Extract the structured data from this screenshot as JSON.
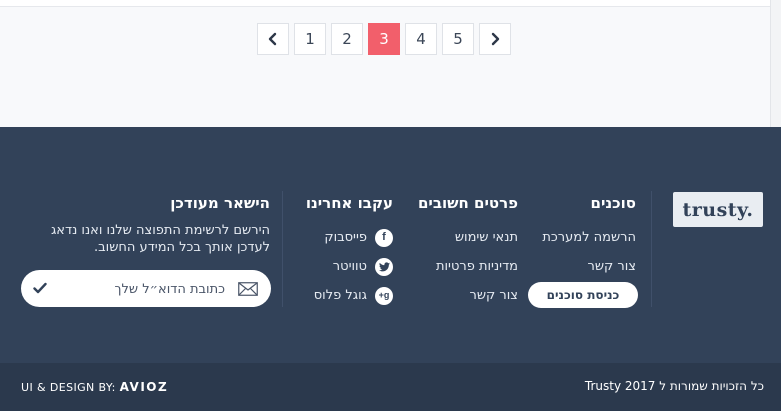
{
  "pagination": {
    "prev_icon": "chevron-left-icon",
    "next_icon": "chevron-right-icon",
    "pages": [
      "1",
      "2",
      "3",
      "4",
      "5"
    ],
    "current": "3",
    "active_color": "#f25f6b"
  },
  "footer": {
    "logo": "trusty.",
    "agents": {
      "title": "סוכנים",
      "links": [
        "הרשמה למערכת",
        "צור קשר"
      ],
      "button": "כניסת סוכנים"
    },
    "info": {
      "title": "פרטים חשובים",
      "links": [
        "תנאי שימוש",
        "מדיניות פרטיות",
        "צור קשר"
      ]
    },
    "follow": {
      "title": "עקבו אחרינו",
      "items": [
        {
          "label": "פייסבוק",
          "icon": "facebook-icon",
          "glyph": "f"
        },
        {
          "label": "טוויטר",
          "icon": "twitter-icon",
          "glyph": "t"
        },
        {
          "label": "גוגל פלוס",
          "icon": "google-plus-icon",
          "glyph": "g+"
        }
      ]
    },
    "newsletter": {
      "title": "הישאר מעודכן",
      "text": "הירשם לרשימת התפוצה שלנו ואנו נדאג לעדכן אותך בכל המידע החשוב.",
      "placeholder": "כתובת הדוא״ל שלך"
    },
    "colors": {
      "background": "#324259",
      "bottom_bar": "#2b394d"
    }
  },
  "bottom": {
    "credit_prefix": "UI & DESIGN BY:",
    "credit_brand": "AVIOZ",
    "copyright": "כל הזכויות שמורות ל Trusty 2017"
  }
}
